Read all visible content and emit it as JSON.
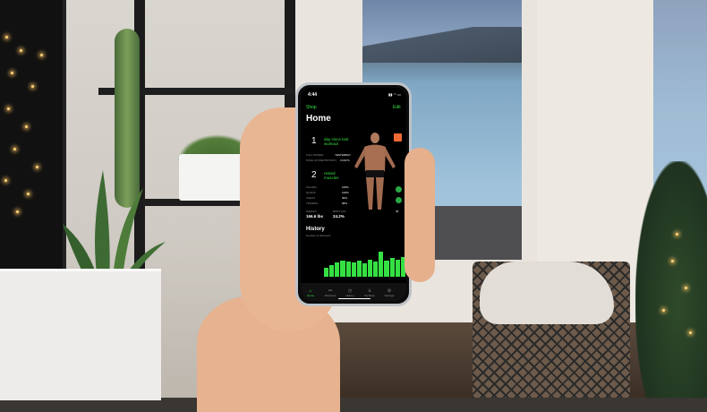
{
  "status_bar": {
    "time": "4:44"
  },
  "nav": {
    "back_label": "Shop",
    "edit_label": "Edit",
    "title": "Home"
  },
  "workout": {
    "days_number": "1",
    "days_text": "day since last workout",
    "stats": [
      {
        "label": "FULL POWER",
        "value": "YESTERDAY"
      },
      {
        "label": "PUSH (HYPERTROPHY)",
        "value": "3 DAYS"
      }
    ],
    "rested_number": "2",
    "rested_text": "rested muscles",
    "muscles": [
      {
        "label": "CALVES",
        "value": "100%"
      },
      {
        "label": "QUADS",
        "value": "100%"
      },
      {
        "label": "CHEST",
        "value": "99%"
      },
      {
        "label": "TRICEPS",
        "value": "98%"
      }
    ],
    "weight_label": "WEIGHT",
    "weight_value": "166.6 lbs",
    "bodyfat_label": "BODY FAT",
    "bodyfat_value": "24.2%"
  },
  "history": {
    "title": "History",
    "subtitle": "Number of Workouts",
    "bar_values": [
      0.35,
      0.45,
      0.55,
      0.6,
      0.58,
      0.55,
      0.6,
      0.5,
      0.62,
      0.58,
      0.95,
      0.6,
      0.7,
      0.65,
      0.75
    ]
  },
  "tabs": [
    {
      "label": "Home",
      "icon": "home-icon",
      "glyph": "⌂",
      "active": true
    },
    {
      "label": "Workouts",
      "icon": "dumbbell-icon",
      "glyph": "⚯",
      "active": false
    },
    {
      "label": "History",
      "icon": "clock-icon",
      "glyph": "◷",
      "active": false
    },
    {
      "label": "My Body",
      "icon": "body-icon",
      "glyph": "♙",
      "active": false
    },
    {
      "label": "Settings",
      "icon": "gear-icon",
      "glyph": "⚙",
      "active": false
    }
  ],
  "colors": {
    "accent": "#35e043",
    "orange": "#ef6a35",
    "background": "#000000"
  }
}
